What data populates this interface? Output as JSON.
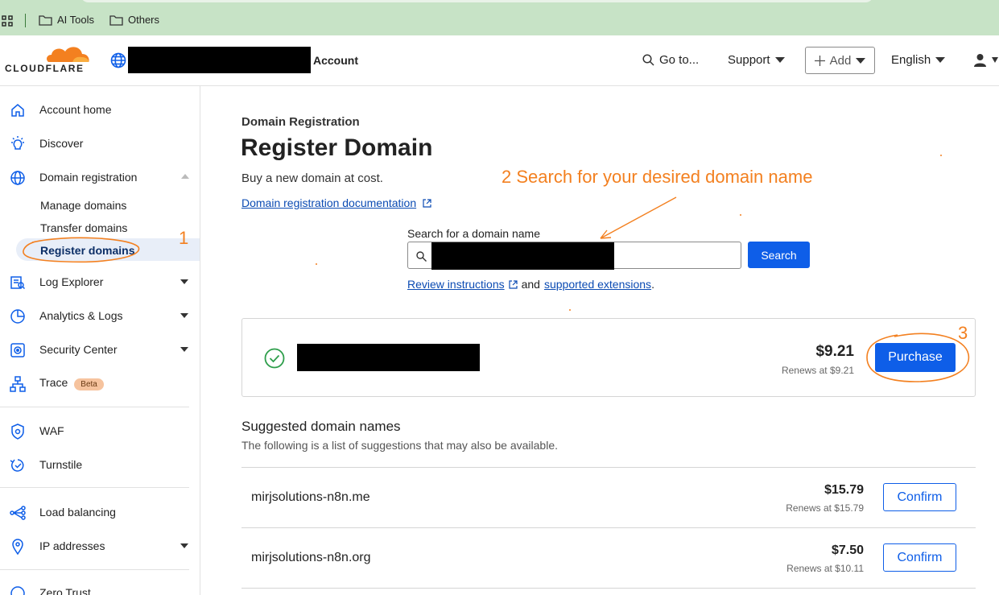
{
  "bookmarks": {
    "items": [
      {
        "label": "AI Tools",
        "icon": "folder-icon"
      },
      {
        "label": "Others",
        "icon": "folder-icon"
      }
    ]
  },
  "header": {
    "logo_text": "CLOUDFLARE",
    "account_label": "Account",
    "goto_label": "Go to...",
    "support_label": "Support",
    "add_label": "Add",
    "language_label": "English"
  },
  "sidebar": {
    "items": [
      {
        "label": "Account home",
        "icon": "home-icon"
      },
      {
        "label": "Discover",
        "icon": "lightbulb-icon"
      },
      {
        "label": "Domain registration",
        "icon": "globe-icon"
      },
      {
        "label": "Log Explorer",
        "icon": "log-explorer-icon"
      },
      {
        "label": "Analytics & Logs",
        "icon": "analytics-icon"
      },
      {
        "label": "Security Center",
        "icon": "security-center-icon"
      },
      {
        "label": "Trace",
        "icon": "trace-icon",
        "badge": "Beta"
      },
      {
        "label": "WAF",
        "icon": "waf-icon"
      },
      {
        "label": "Turnstile",
        "icon": "turnstile-icon"
      },
      {
        "label": "Load balancing",
        "icon": "load-balancing-icon"
      },
      {
        "label": "IP addresses",
        "icon": "ip-addresses-icon"
      },
      {
        "label": "Zero Trust",
        "icon": "zero-trust-icon"
      }
    ],
    "sub_items": [
      "Manage domains",
      "Transfer domains",
      "Register domains"
    ]
  },
  "main": {
    "eyebrow": "Domain Registration",
    "title": "Register Domain",
    "subtitle": "Buy a new domain at cost.",
    "doc_link": "Domain registration documentation",
    "search": {
      "label": "Search for a domain name",
      "button": "Search"
    },
    "review": {
      "link1": "Review instructions",
      "joiner": "and",
      "link2": "supported extensions",
      "end": "."
    },
    "result": {
      "price": "$9.21",
      "renews": "Renews at $9.21",
      "button": "Purchase"
    },
    "suggestions": {
      "title": "Suggested domain names",
      "subtitle": "The following is a list of suggestions that may also be available.",
      "rows": [
        {
          "domain": "mirjsolutions-n8n.me",
          "price": "$15.79",
          "renews": "Renews at $15.79",
          "button": "Confirm"
        },
        {
          "domain": "mirjsolutions-n8n.org",
          "price": "$7.50",
          "renews": "Renews at $10.11",
          "button": "Confirm"
        }
      ]
    }
  },
  "annotations": {
    "step1": "1",
    "step2": "2   Search for your desired domain name",
    "step3": "3"
  },
  "colors": {
    "accent_orange": "#f38020",
    "primary_blue": "#0e5ee8",
    "link_blue": "#0b4bb3",
    "success_green": "#2e9e4b",
    "bookmark_bar": "#c7e3c6"
  }
}
